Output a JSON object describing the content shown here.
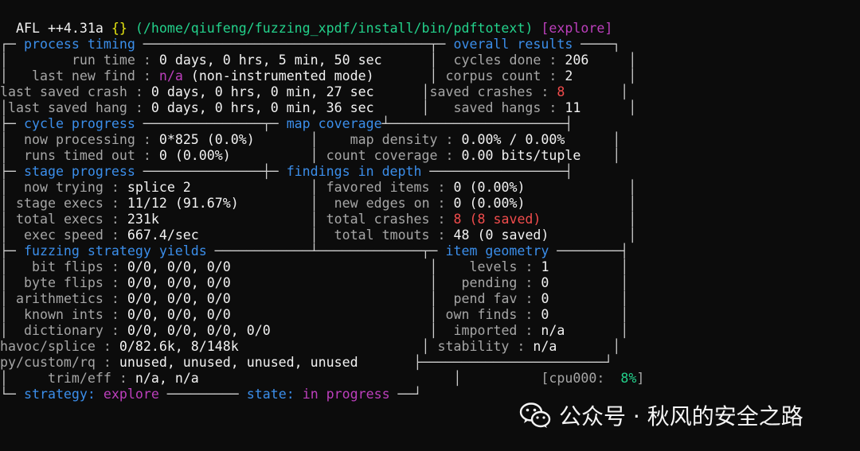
{
  "title": {
    "app": "AFL ++4.31a",
    "braces": "{}",
    "path": "(/home/qiufeng/fuzzing_xpdf/install/bin/pdftotext)",
    "mode": "[explore]"
  },
  "sections": {
    "process_timing": "process timing",
    "overall_results": "overall results",
    "cycle_progress": "cycle progress",
    "map_coverage": "map coverage",
    "stage_progress": "stage progress",
    "findings_in_depth": "findings in depth",
    "fuzzing_strategy_yields": "fuzzing strategy yields",
    "item_geometry": "item geometry"
  },
  "process_timing": {
    "run_time_label": "run time",
    "run_time": "0 days, 0 hrs, 5 min, 50 sec",
    "last_new_find_label": "last new find",
    "last_new_find_value": "n/a",
    "last_new_find_note": "(non-instrumented mode)",
    "last_saved_crash_label": "last saved crash",
    "last_saved_crash": "0 days, 0 hrs, 0 min, 27 sec",
    "last_saved_hang_label": "last saved hang",
    "last_saved_hang": "0 days, 0 hrs, 0 min, 36 sec"
  },
  "overall_results": {
    "cycles_done_label": "cycles done",
    "cycles_done": "206",
    "corpus_count_label": "corpus count",
    "corpus_count": "2",
    "saved_crashes_label": "saved crashes",
    "saved_crashes": "8",
    "saved_hangs_label": "saved hangs",
    "saved_hangs": "11"
  },
  "cycle_progress": {
    "now_processing_label": "now processing",
    "now_processing": "0*825 (0.0%)",
    "runs_timed_out_label": "runs timed out",
    "runs_timed_out": "0 (0.00%)"
  },
  "map_coverage": {
    "map_density_label": "map density",
    "map_density": "0.00% / 0.00%",
    "count_coverage_label": "count coverage",
    "count_coverage": "0.00 bits/tuple"
  },
  "stage_progress": {
    "now_trying_label": "now trying",
    "now_trying": "splice 2",
    "stage_execs_label": "stage execs",
    "stage_execs": "11/12 (91.67%)",
    "total_execs_label": "total execs",
    "total_execs": "231k",
    "exec_speed_label": "exec speed",
    "exec_speed": "667.4/sec"
  },
  "findings": {
    "favored_items_label": "favored items",
    "favored_items": "0 (0.00%)",
    "new_edges_on_label": "new edges on",
    "new_edges_on": "0 (0.00%)",
    "total_crashes_label": "total crashes",
    "total_crashes": "8 (8 saved)",
    "total_tmouts_label": "total tmouts",
    "total_tmouts": "48 (0 saved)"
  },
  "yields": {
    "bit_flips_label": "bit flips",
    "bit_flips": "0/0, 0/0, 0/0",
    "byte_flips_label": "byte flips",
    "byte_flips": "0/0, 0/0, 0/0",
    "arithmetics_label": "arithmetics",
    "arithmetics": "0/0, 0/0, 0/0",
    "known_ints_label": "known ints",
    "known_ints": "0/0, 0/0, 0/0",
    "dictionary_label": "dictionary",
    "dictionary": "0/0, 0/0, 0/0, 0/0",
    "havoc_splice_label": "havoc/splice",
    "havoc_splice": "0/82.6k, 8/148k",
    "py_custom_rq_label": "py/custom/rq",
    "py_custom_rq": "unused, unused, unused, unused",
    "trim_eff_label": "trim/eff",
    "trim_eff": "n/a, n/a"
  },
  "item_geometry": {
    "levels_label": "levels",
    "levels": "1",
    "pending_label": "pending",
    "pending": "0",
    "pend_fav_label": "pend fav",
    "pend_fav": "0",
    "own_finds_label": "own finds",
    "own_finds": "0",
    "imported_label": "imported",
    "imported": "n/a",
    "stability_label": "stability",
    "stability": "n/a"
  },
  "cpu": {
    "label": "[cpu000:",
    "value": "8%",
    "close": "]"
  },
  "footer": {
    "strategy_label": "strategy:",
    "strategy": "explore",
    "state_label": "state:",
    "state": "in progress"
  },
  "watermark": {
    "icon": "wechat-icon",
    "text": "公众号 · 秋风的安全之路"
  }
}
